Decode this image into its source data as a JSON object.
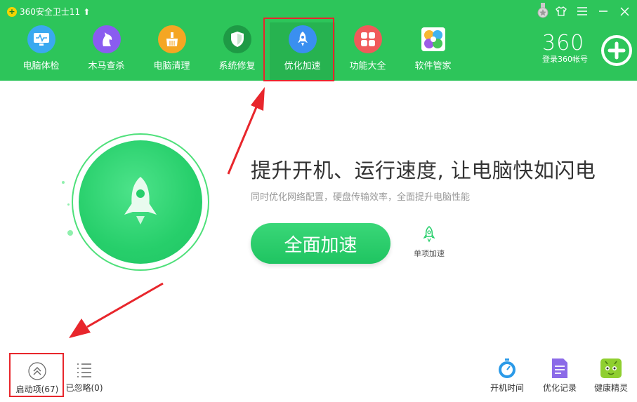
{
  "app": {
    "title": "360安全卫士11",
    "upgrade_icon": "up-arrow-icon"
  },
  "nav": {
    "items": [
      {
        "label": "电脑体检",
        "icon": "monitor-pulse-icon",
        "color": "#3aa9f0"
      },
      {
        "label": "木马查杀",
        "icon": "horse-icon",
        "color": "#8a5cf0"
      },
      {
        "label": "电脑清理",
        "icon": "broom-icon",
        "color": "#f5a623"
      },
      {
        "label": "系统修复",
        "icon": "shield-icon",
        "color": "#1e9a45"
      },
      {
        "label": "优化加速",
        "icon": "rocket-icon",
        "color": "#3a8ff0"
      },
      {
        "label": "功能大全",
        "icon": "grid-icon",
        "color": "#f05a5a"
      },
      {
        "label": "软件管家",
        "icon": "flower-icon",
        "color": "#ffffff"
      }
    ]
  },
  "login": {
    "logo": "360",
    "label": "登录360帐号"
  },
  "main": {
    "headline": "提升开机、运行速度, 让电脑快如闪电",
    "subline": "同时优化网络配置，硬盘传输效率，全面提升电脑性能",
    "speed_button": "全面加速",
    "single_label": "单项加速"
  },
  "bottom": {
    "startup": "启动项(67)",
    "ignored": "已忽略(0)",
    "boot_time": "开机时间",
    "record": "优化记录",
    "spirit": "健康精灵"
  },
  "colors": {
    "brand_green": "#2dc55a",
    "highlight_red": "#e8262c"
  }
}
